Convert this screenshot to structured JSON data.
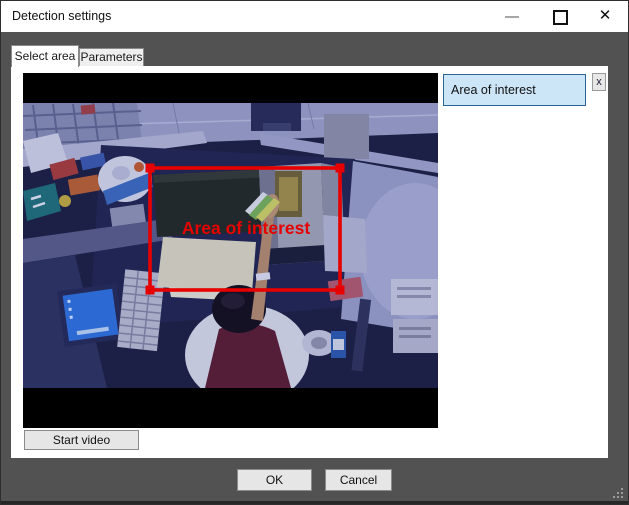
{
  "window": {
    "title": "Detection settings"
  },
  "icons": {
    "minimize": "dash-shape",
    "maximize": "square-outline",
    "close": "✕",
    "resize_grip": "dot-triangle"
  },
  "tabs": {
    "select_area": "Select area",
    "parameters": "Parameters"
  },
  "area_panel": {
    "input_value": "Area of interest",
    "remove_label": "x"
  },
  "video_overlay": {
    "roi_label": "Area of interest"
  },
  "actions": {
    "start_video": "Start video",
    "ok": "OK",
    "cancel": "Cancel"
  },
  "colors": {
    "roi_red": "#e60000",
    "input_bg": "#cde6f7",
    "input_border": "#2c6496",
    "dialog_bg": "#525252",
    "titlebar_bg": "#ffffff"
  }
}
